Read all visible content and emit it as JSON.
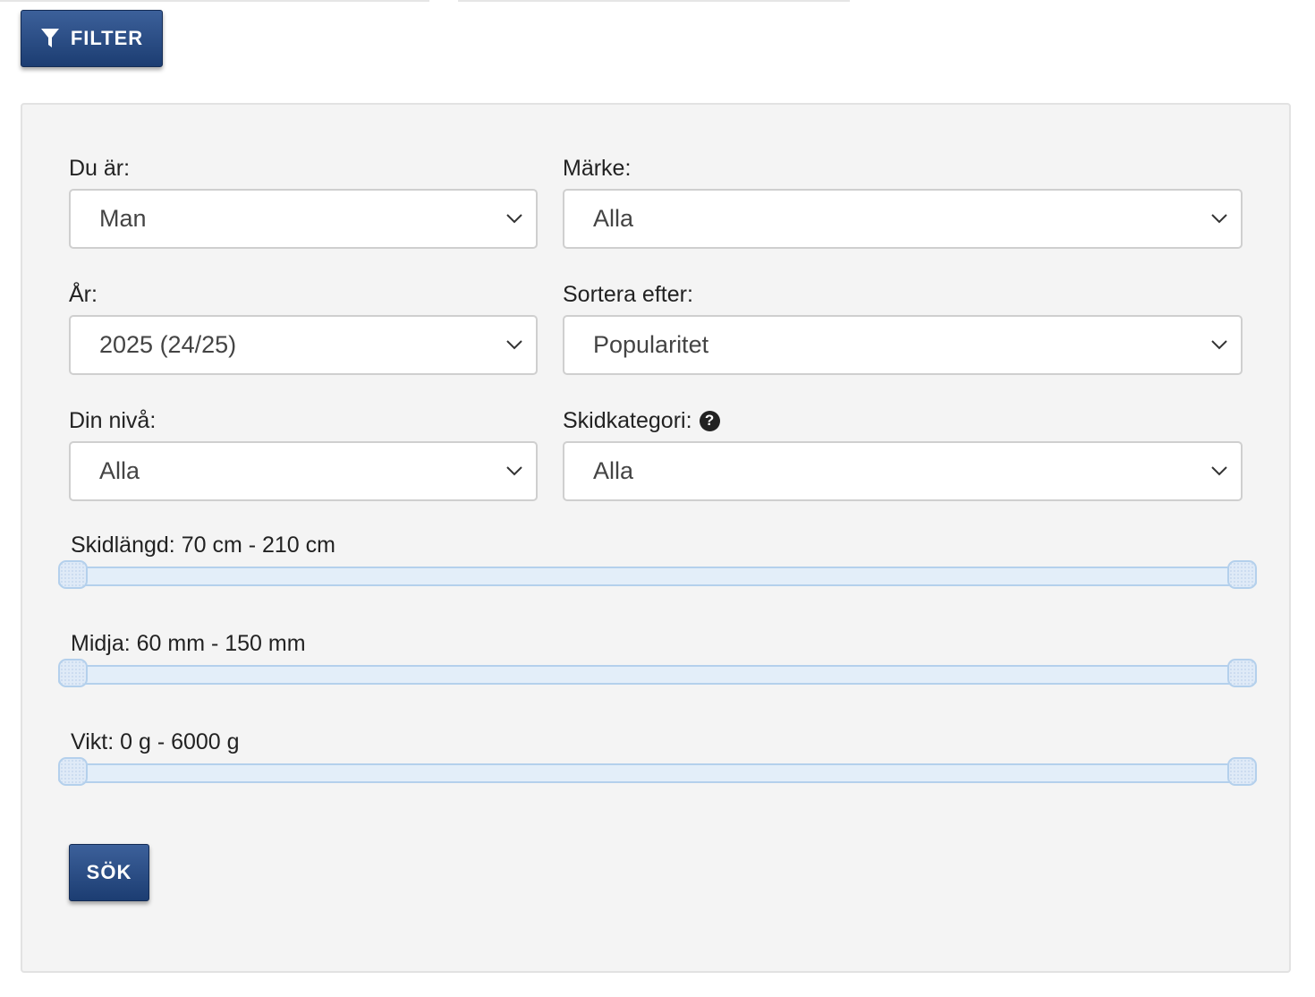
{
  "filter_button": {
    "label": "FILTER"
  },
  "fields": {
    "gender": {
      "label": "Du är:",
      "value": "Man"
    },
    "brand": {
      "label": "Märke:",
      "value": "Alla"
    },
    "year": {
      "label": "År:",
      "value": "2025 (24/25)"
    },
    "sort": {
      "label": "Sortera efter:",
      "value": "Popularitet"
    },
    "level": {
      "label": "Din nivå:",
      "value": "Alla"
    },
    "category": {
      "label": "Skidkategori:",
      "value": "Alla",
      "help": "?"
    }
  },
  "sliders": {
    "length": {
      "label": "Skidlängd: 70 cm - 210 cm",
      "min": 70,
      "max": 210,
      "unit": "cm"
    },
    "waist": {
      "label": "Midja: 60 mm - 150 mm",
      "min": 60,
      "max": 150,
      "unit": "mm"
    },
    "weight": {
      "label": "Vikt: 0 g - 6000 g",
      "min": 0,
      "max": 6000,
      "unit": "g"
    }
  },
  "search_button": {
    "label": "SÖK"
  },
  "colors": {
    "button": "#274a82",
    "panel": "#f4f4f4",
    "slider": "#e3eef9"
  }
}
